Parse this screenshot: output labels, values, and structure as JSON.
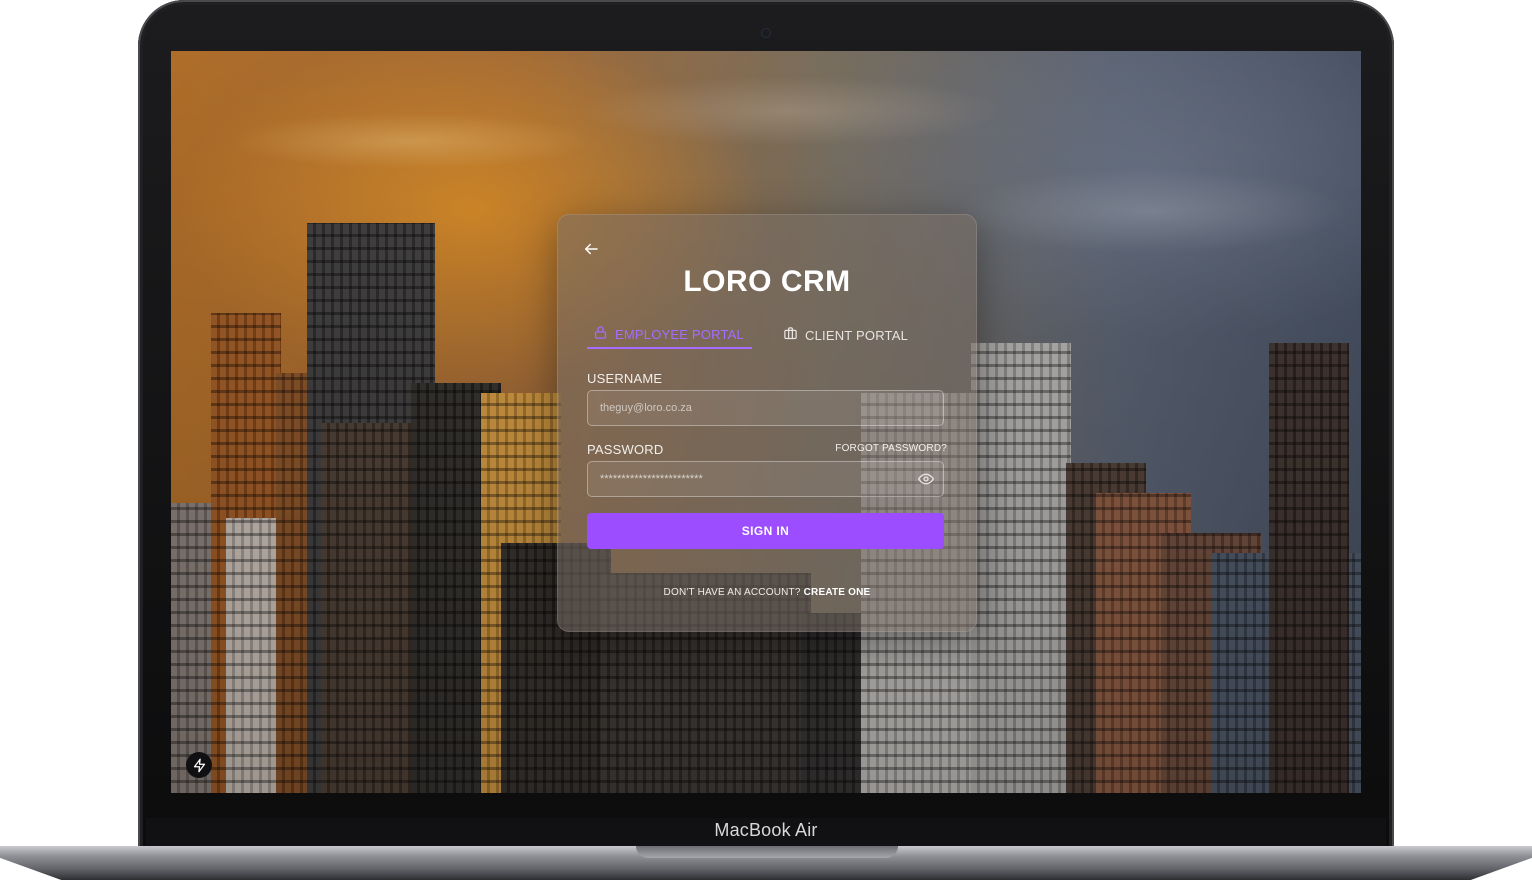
{
  "device": {
    "brand_label": "MacBook Air"
  },
  "login": {
    "title": "LORO CRM",
    "tabs": [
      {
        "label": "EMPLOYEE PORTAL",
        "icon": "lock-icon",
        "active": true
      },
      {
        "label": "CLIENT PORTAL",
        "icon": "briefcase-icon",
        "active": false
      }
    ],
    "username": {
      "label": "USERNAME",
      "placeholder": "theguy@loro.co.za"
    },
    "password": {
      "label": "PASSWORD",
      "value": "************************",
      "forgot_label": "FORGOT PASSWORD?"
    },
    "submit_label": "SIGN IN",
    "footer": {
      "prompt": "DON'T HAVE AN ACCOUNT?",
      "link": "CREATE ONE"
    },
    "colors": {
      "accent": "#9b4dff",
      "active_tab": "#a66bff"
    }
  }
}
